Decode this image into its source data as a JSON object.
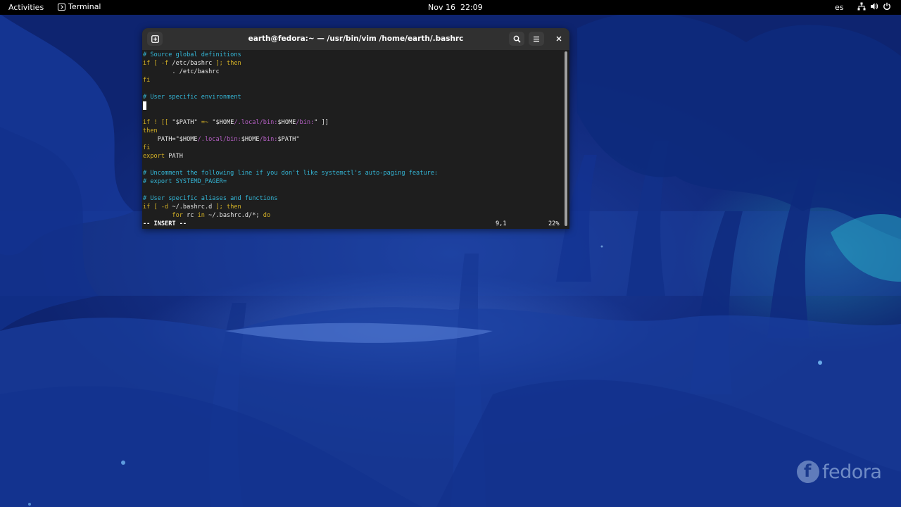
{
  "topbar": {
    "activities": "Activities",
    "app_name": "Terminal",
    "clock": "Nov 16  22:09",
    "language": "es",
    "icons": [
      "network-icon",
      "volume-icon",
      "power-icon"
    ]
  },
  "window": {
    "title": "earth@fedora:~ — /usr/bin/vim /home/earth/.bashrc"
  },
  "editor": {
    "lines": [
      "# Source global definitions",
      "if [ -f /etc/bashrc ]; then",
      "        . /etc/bashrc",
      "fi",
      "",
      "# User specific environment",
      "",
      "",
      "if ! [[ \"$PATH\" =~ \"$HOME/.local/bin:$HOME/bin:\" ]]",
      "then",
      "    PATH=\"$HOME/.local/bin:$HOME/bin:$PATH\"",
      "fi",
      "export PATH",
      "",
      "# Uncomment the following line if you don't like systemctl's auto-paging feature:",
      "# export SYSTEMD_PAGER=",
      "",
      "# User specific aliases and functions",
      "if [ -d ~/.bashrc.d ]; then",
      "        for rc in ~/.bashrc.d/*; do"
    ],
    "status_mode": "-- INSERT --",
    "status_position": "9,1",
    "status_percent": "22%"
  },
  "branding": {
    "logo_text": "fedora"
  },
  "colors": {
    "comment": "#34b6d6",
    "keyword": "#d3b026",
    "path": "#b55fc4",
    "terminal_bg": "#1e1e1e",
    "headerbar_bg": "#303030"
  }
}
